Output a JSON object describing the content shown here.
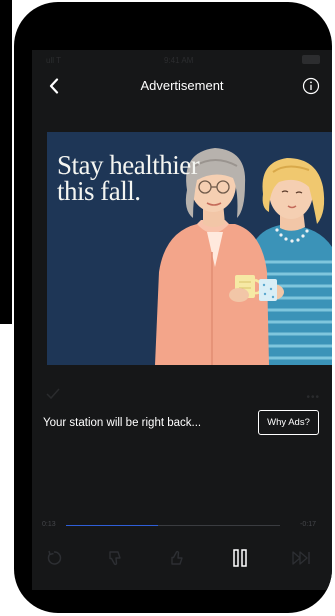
{
  "status_bar": {
    "carrier": "ull T",
    "time": "9:41 AM"
  },
  "nav": {
    "title": "Advertisement"
  },
  "ad": {
    "headline_line1": "Stay healthier",
    "headline_line2": "this fall."
  },
  "message": {
    "text": "Your station will be right back...",
    "why_ads_label": "Why Ads?"
  },
  "player": {
    "elapsed": "0:13",
    "remaining": "-0:17",
    "progress_fraction": 0.43
  },
  "colors": {
    "screen_bg": "#161718",
    "ad_bg": "#1e3656",
    "accent": "#2f5fd8"
  },
  "icons": {
    "back": "chevron-left-icon",
    "info": "info-circle-icon",
    "replay": "replay-icon",
    "thumb_down": "thumb-down-icon",
    "thumb_up": "thumb-up-icon",
    "pause": "pause-icon",
    "skip": "skip-forward-icon"
  }
}
